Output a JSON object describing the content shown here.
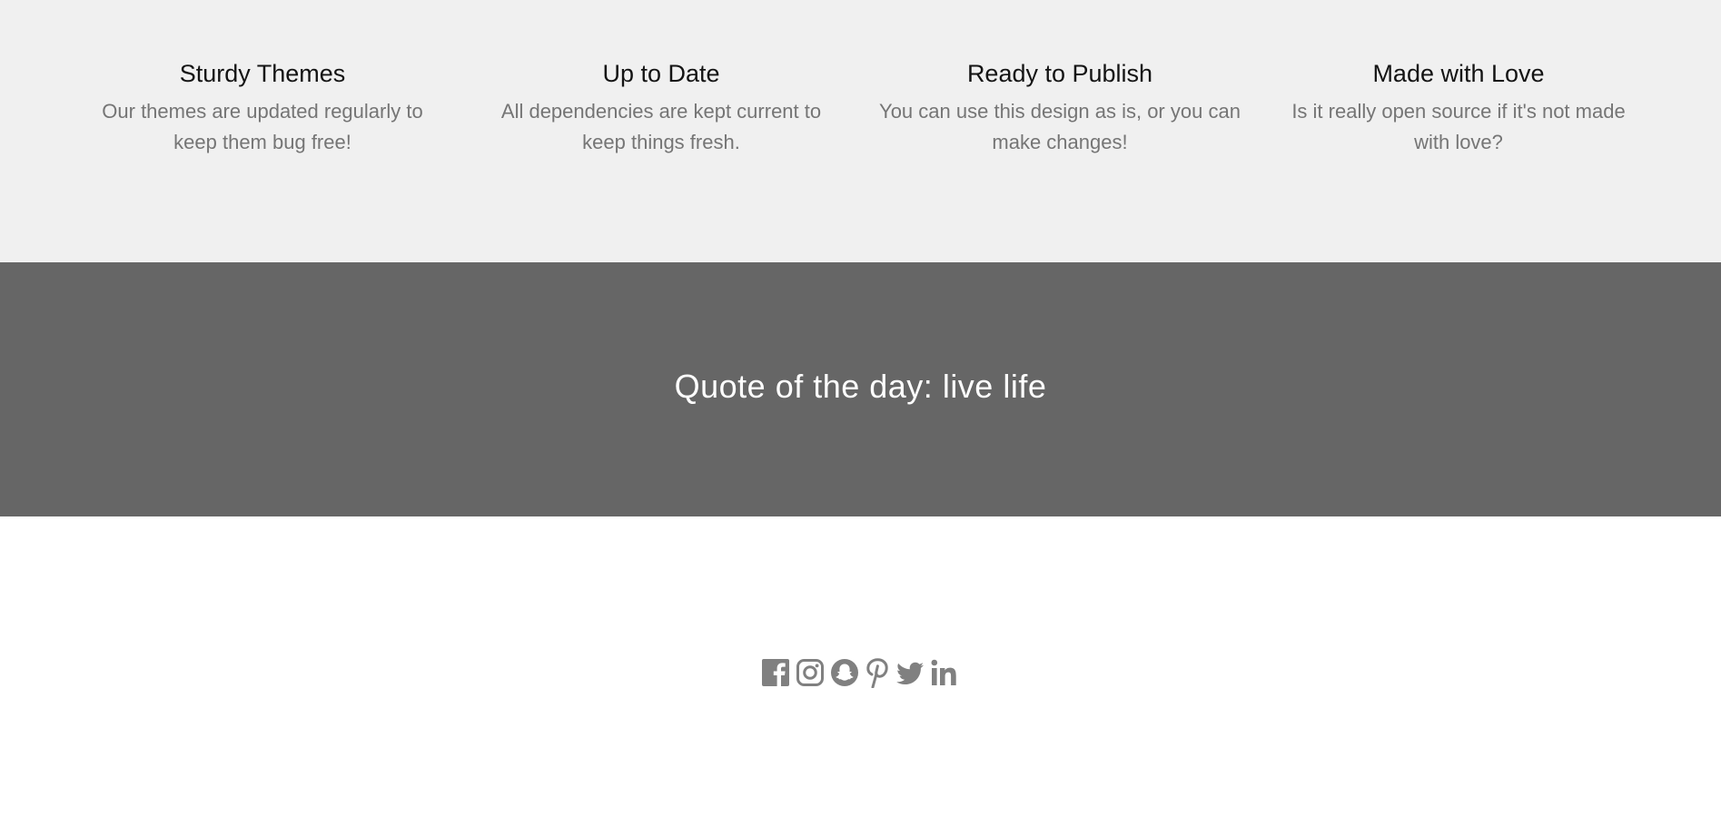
{
  "features": [
    {
      "title": "Sturdy Themes",
      "text": "Our themes are updated regularly to keep them bug free!"
    },
    {
      "title": "Up to Date",
      "text": "All dependencies are kept current to keep things fresh."
    },
    {
      "title": "Ready to Publish",
      "text": "You can use this design as is, or you can make changes!"
    },
    {
      "title": "Made with Love",
      "text": "Is it really open source if it's not made with love?"
    }
  ],
  "quote": {
    "text": "Quote of the day: live life"
  },
  "social": {
    "icons": [
      "facebook-icon",
      "instagram-icon",
      "snapchat-icon",
      "pinterest-icon",
      "twitter-icon",
      "linkedin-icon"
    ],
    "color": "#808080"
  },
  "colors": {
    "features_bg": "#f0f0f0",
    "quote_bg": "#666666",
    "footer_bg": "#ffffff"
  }
}
